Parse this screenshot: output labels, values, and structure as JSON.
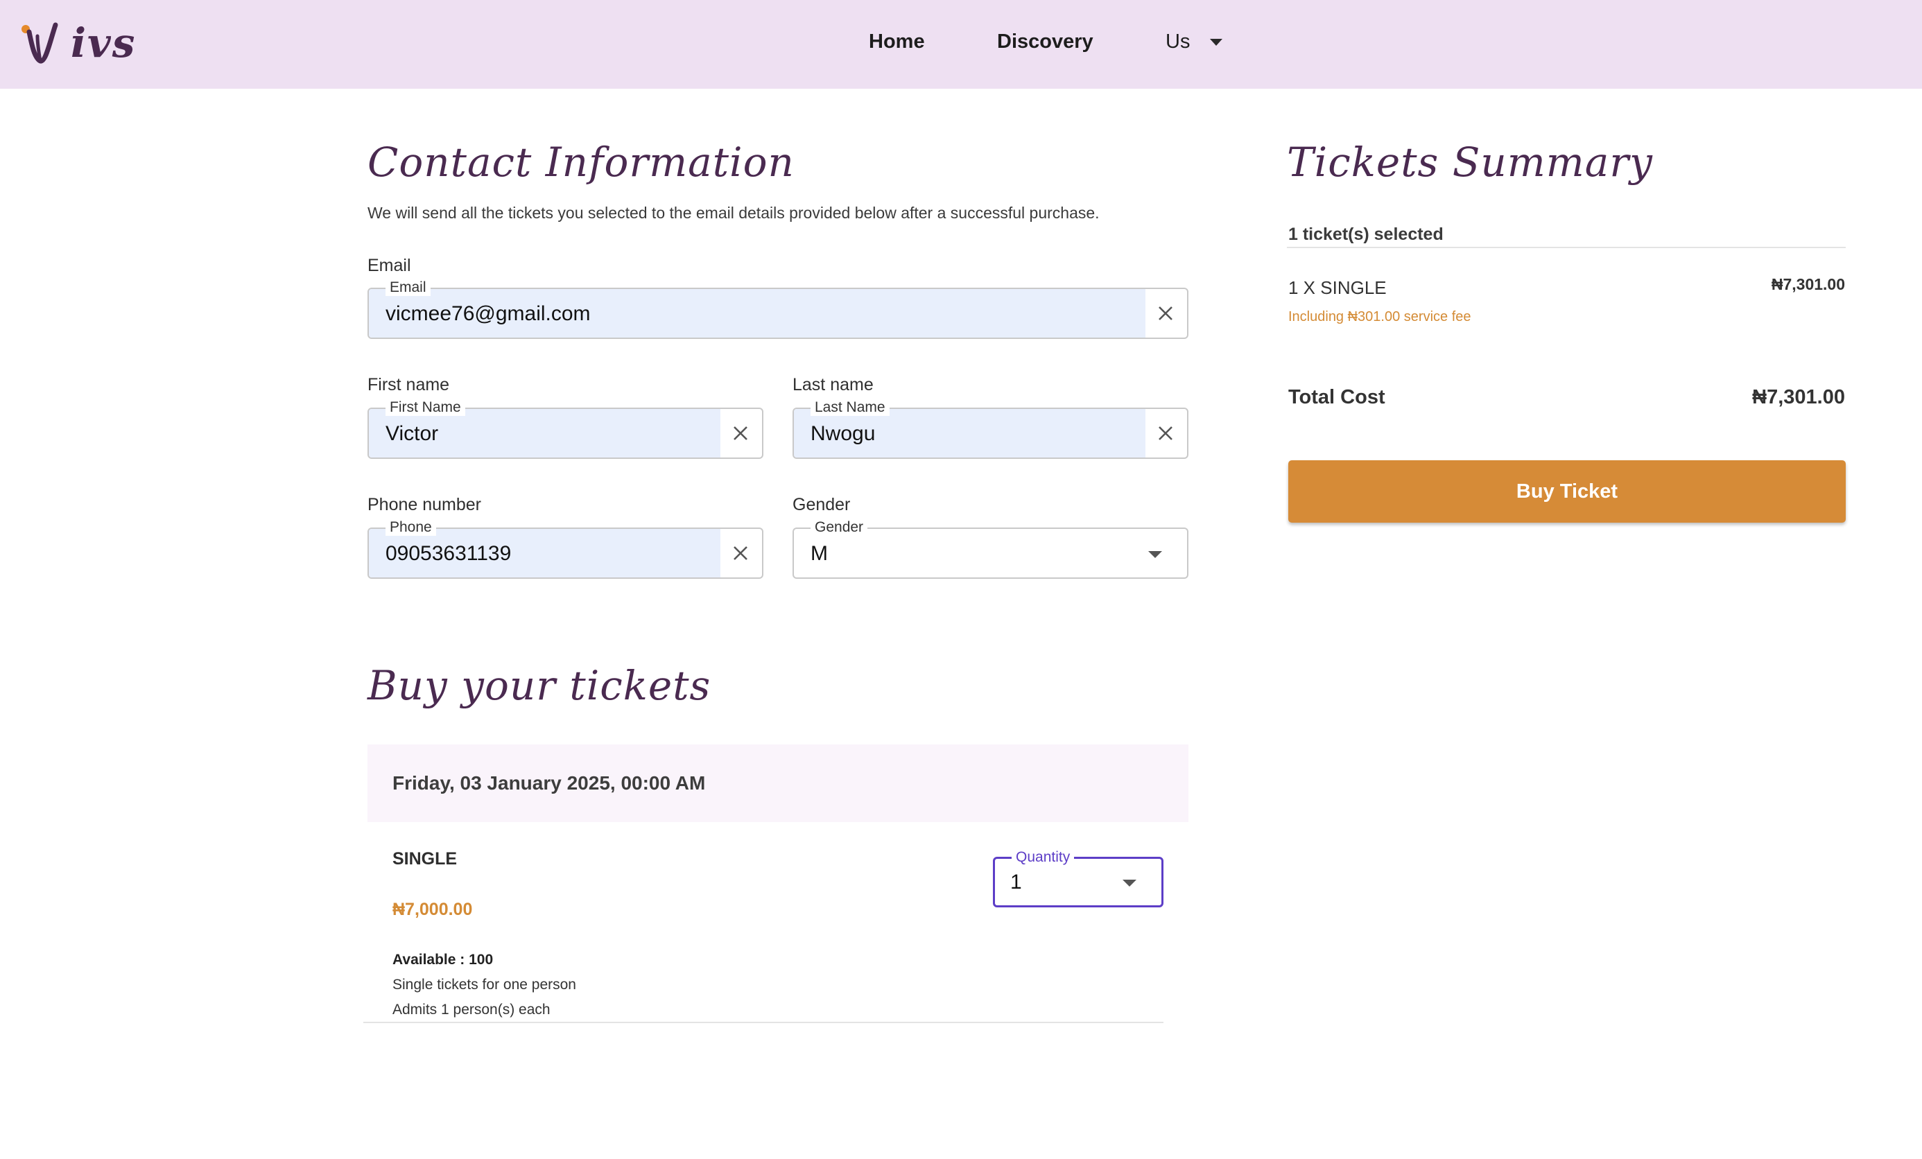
{
  "header": {
    "logo_text": "ivs",
    "nav": [
      {
        "label": "Home"
      },
      {
        "label": "Discovery"
      },
      {
        "label": "Us"
      }
    ]
  },
  "contact": {
    "title": "Contact Information",
    "description": "We will send all the tickets you selected to the email details provided below after a successful purchase.",
    "email": {
      "label": "Email",
      "legend": "Email",
      "value": "vicmee76@gmail.com"
    },
    "first_name": {
      "label": "First name",
      "legend": "First Name",
      "value": "Victor"
    },
    "last_name": {
      "label": "Last name",
      "legend": "Last Name",
      "value": "Nwogu"
    },
    "phone": {
      "label": "Phone number",
      "legend": "Phone",
      "value": "09053631139"
    },
    "gender": {
      "label": "Gender",
      "legend": "Gender",
      "value": "M"
    }
  },
  "buy": {
    "title": "Buy your tickets",
    "date": "Friday, 03 January 2025, 00:00 AM",
    "ticket": {
      "name": "SINGLE",
      "price": "₦7,000.00",
      "available": "Available : 100",
      "description": "Single tickets for one person",
      "admits": "Admits 1 person(s) each",
      "quantity_legend": "Quantity",
      "quantity_value": "1"
    }
  },
  "summary": {
    "title": "Tickets Summary",
    "selected": "1 ticket(s) selected",
    "line_label": "1 X SINGLE",
    "line_amount": "₦7,301.00",
    "fee_note": "Including ₦301.00 service fee",
    "total_label": "Total Cost",
    "total_amount": "₦7,301.00",
    "buy_button": "Buy Ticket"
  },
  "colors": {
    "header_bg": "#eee0f2",
    "heading": "#4a2a50",
    "accent_orange": "#d68b37",
    "field_fill": "#e8effc",
    "focus_purple": "#5d3ec7"
  },
  "icons": [
    "logo-icon",
    "caret-down-icon",
    "close-icon",
    "dropdown-arrow-icon"
  ]
}
